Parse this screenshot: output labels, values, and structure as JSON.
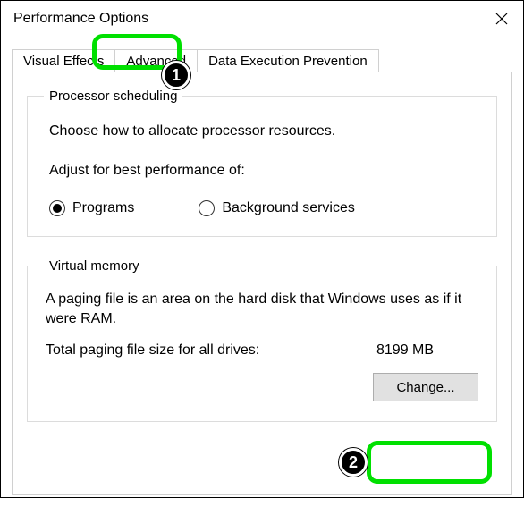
{
  "window": {
    "title": "Performance Options"
  },
  "tabs": {
    "visual_effects": "Visual Effects",
    "advanced": "Advanced",
    "dep": "Data Execution Prevention"
  },
  "processor": {
    "legend": "Processor scheduling",
    "desc": "Choose how to allocate processor resources.",
    "adjust_label": "Adjust for best performance of:",
    "option_programs": "Programs",
    "option_background": "Background services"
  },
  "vm": {
    "legend": "Virtual memory",
    "desc": "A paging file is an area on the hard disk that Windows uses as if it were RAM.",
    "total_label": "Total paging file size for all drives:",
    "total_value": "8199 MB",
    "change_btn": "Change..."
  },
  "annotations": {
    "one": "1",
    "two": "2"
  }
}
